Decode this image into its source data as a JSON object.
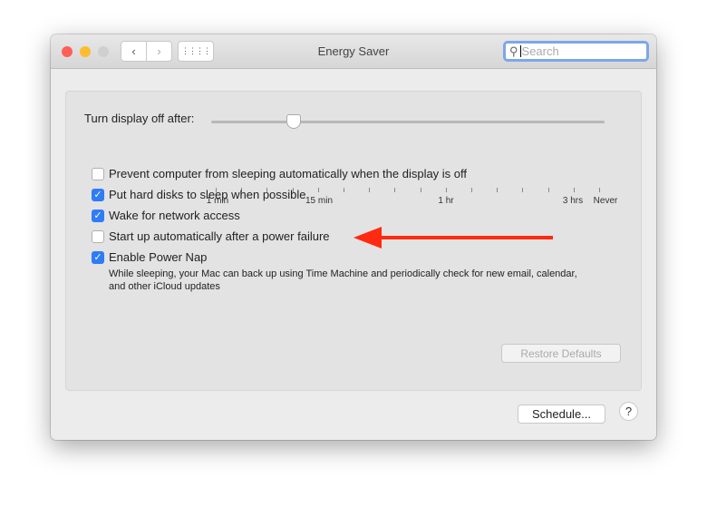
{
  "window": {
    "title": "Energy Saver"
  },
  "search": {
    "placeholder": "Search"
  },
  "display_sleep": {
    "label": "Turn display off after:",
    "value_minutes": 10,
    "tick_labels": [
      "1 min",
      "15 min",
      "1 hr",
      "3 hrs",
      "Never"
    ]
  },
  "options": [
    {
      "label": "Prevent computer from sleeping automatically when the display is off",
      "checked": false
    },
    {
      "label": "Put hard disks to sleep when possible",
      "checked": true
    },
    {
      "label": "Wake for network access",
      "checked": true
    },
    {
      "label": "Start up automatically after a power failure",
      "checked": false
    },
    {
      "label": "Enable Power Nap",
      "checked": true
    }
  ],
  "power_nap_description": "While sleeping, your Mac can back up using Time Machine and periodically check for new email, calendar, and other iCloud updates",
  "buttons": {
    "restore": "Restore Defaults",
    "schedule": "Schedule...",
    "help": "?"
  },
  "annotation": {
    "arrow_color": "#ff2a10"
  }
}
